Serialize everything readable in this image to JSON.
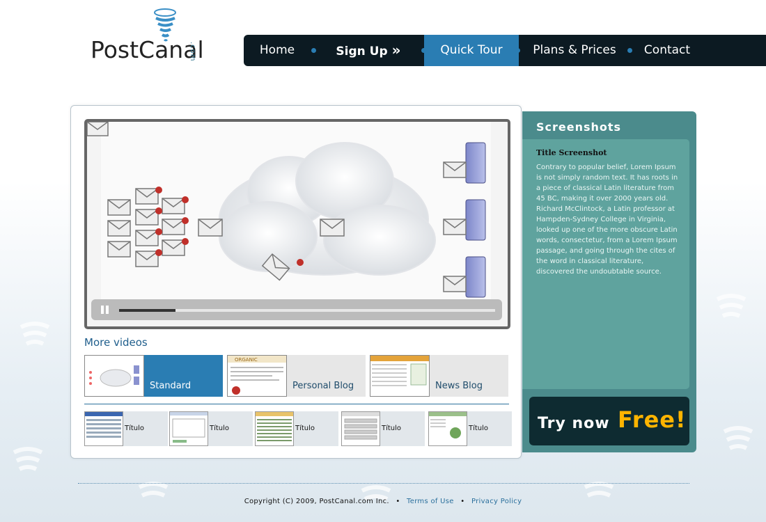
{
  "brand": {
    "name": "PostCanal",
    "suffix": ".com"
  },
  "nav": [
    {
      "label": "Home"
    },
    {
      "label": "Sign Up",
      "chevron": "»"
    },
    {
      "label": "Quick Tour",
      "active": true
    },
    {
      "label": "Plans & Prices"
    },
    {
      "label": "Contact"
    }
  ],
  "player": {
    "progress": 0.15
  },
  "more_videos": {
    "title": "More videos",
    "items": [
      {
        "label": "Standard",
        "active": true
      },
      {
        "label": "Personal Blog"
      },
      {
        "label": "News Blog"
      }
    ]
  },
  "screenshots_row": [
    {
      "label": "Título"
    },
    {
      "label": "Título"
    },
    {
      "label": "Título"
    },
    {
      "label": "Título"
    },
    {
      "label": "Título"
    }
  ],
  "sidebar": {
    "title": "Screenshots",
    "heading": "Title Screenshot",
    "body": "Contrary to popular belief, Lorem Ipsum is not simply random text. It has roots in a piece of classical Latin literature from 45 BC, making it over 2000 years old. Richard McClintock, a Latin professor at Hampden-Sydney College in Virginia, looked up one of the more obscure Latin words, consectetur, from a Lorem Ipsum passage, and going through the cites of the word in classical literature, discovered the undoubtable source."
  },
  "cta": {
    "text": "Try now",
    "highlight": "Free!"
  },
  "footer": {
    "copyright": "Copyright (C) 2009, PostCanal.com Inc.",
    "terms": "Terms of Use",
    "privacy": "Privacy Policy"
  },
  "colors": {
    "accent": "#2a7db3",
    "nav_bg": "#0c1a22",
    "sidebar": "#4b8b8c",
    "cta_free": "#ffb400"
  }
}
